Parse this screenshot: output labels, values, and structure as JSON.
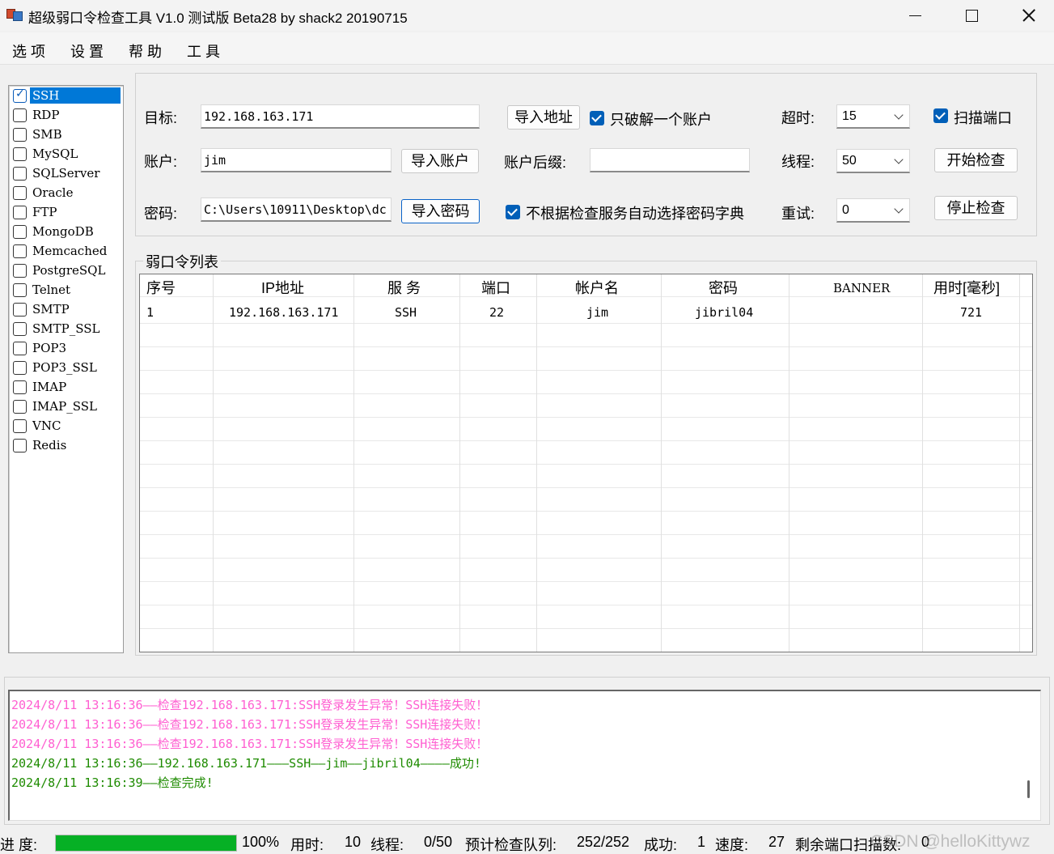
{
  "window": {
    "title": "超级弱口令检查工具 V1.0 测试版 Beta28 by shack2 20190715"
  },
  "menu": [
    "选项",
    "设置",
    "帮助",
    "工具"
  ],
  "protocols": [
    {
      "label": "SSH",
      "checked": true
    },
    {
      "label": "RDP",
      "checked": false
    },
    {
      "label": "SMB",
      "checked": false
    },
    {
      "label": "MySQL",
      "checked": false
    },
    {
      "label": "SQLServer",
      "checked": false
    },
    {
      "label": "Oracle",
      "checked": false
    },
    {
      "label": "FTP",
      "checked": false
    },
    {
      "label": "MongoDB",
      "checked": false
    },
    {
      "label": "Memcached",
      "checked": false
    },
    {
      "label": "PostgreSQL",
      "checked": false
    },
    {
      "label": "Telnet",
      "checked": false
    },
    {
      "label": "SMTP",
      "checked": false
    },
    {
      "label": "SMTP_SSL",
      "checked": false
    },
    {
      "label": "POP3",
      "checked": false
    },
    {
      "label": "POP3_SSL",
      "checked": false
    },
    {
      "label": "IMAP",
      "checked": false
    },
    {
      "label": "IMAP_SSL",
      "checked": false
    },
    {
      "label": "VNC",
      "checked": false
    },
    {
      "label": "Redis",
      "checked": false
    }
  ],
  "config": {
    "target_label": "目标:",
    "target_value": "192.168.163.171",
    "import_address": "导入地址",
    "only_one_account": "只破解一个账户",
    "timeout_label": "超时:",
    "timeout_value": "15",
    "scan_port": "扫描端口",
    "account_label": "账户:",
    "account_value": "jim",
    "import_account": "导入账户",
    "account_suffix_label": "账户后缀:",
    "account_suffix_value": "",
    "threads_label": "线程:",
    "threads_value": "50",
    "start_check": "开始检查",
    "password_label": "密码:",
    "password_value": "C:\\Users\\10911\\Desktop\\dc",
    "import_password": "导入密码",
    "no_auto_dict": "不根据检查服务自动选择密码字典",
    "retry_label": "重试:",
    "retry_value": "0",
    "stop_check": "停止检查"
  },
  "results": {
    "group_title": "弱口令列表",
    "columns": [
      "序号",
      "IP地址",
      "服 务",
      "端口",
      "帐户名",
      "密码",
      "BANNER",
      "用时[毫秒]"
    ],
    "rows": [
      [
        "1",
        "192.168.163.171",
        "SSH",
        "22",
        "jim",
        "jibril04",
        "",
        "721"
      ]
    ]
  },
  "log": [
    {
      "text": "2024/8/11 13:16:36——检查192.168.163.171:SSH登录发生异常！SSH连接失败！",
      "color": "pink"
    },
    {
      "text": "2024/8/11 13:16:36——检查192.168.163.171:SSH登录发生异常！SSH连接失败！",
      "color": "pink"
    },
    {
      "text": "2024/8/11 13:16:36——检查192.168.163.171:SSH登录发生异常！SSH连接失败！",
      "color": "pink"
    },
    {
      "text": "2024/8/11 13:16:36——192.168.163.171———SSH——jim——jibril04————成功!",
      "color": "green"
    },
    {
      "text": "2024/8/11 13:16:39——检查完成!",
      "color": "green"
    }
  ],
  "status": {
    "progress_label": "进 度:",
    "progress_fraction": 1.0,
    "progress_text": "100%",
    "time_label": "用时:",
    "time_value": "10",
    "threads_label": "线程:",
    "threads_value": "0/50",
    "queue_label": "预计检查队列:",
    "queue_value": "252/252",
    "success_label": "成功:",
    "success_value": "1",
    "speed_label": "速度:",
    "speed_value": "27",
    "remaining_label": "剩余端口扫描数:",
    "remaining_value": "0"
  },
  "watermark": "CSDN @helloKittywz",
  "colors": {
    "accent": "#005fb8",
    "selection": "#0078d7",
    "progress": "#06b025",
    "log_error": "#ff5fd1",
    "log_success": "#1e8b00"
  }
}
